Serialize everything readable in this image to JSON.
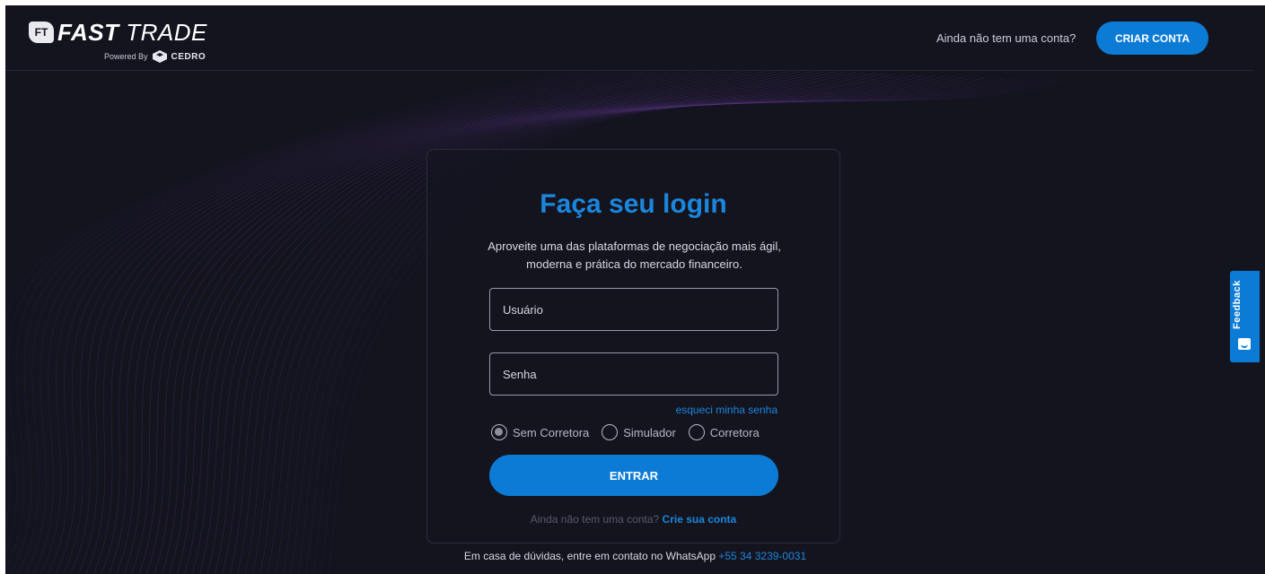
{
  "header": {
    "logo": {
      "badge": "FT",
      "brand_bold": "FAST",
      "brand_light": "TRADE",
      "powered_by": "Powered By",
      "partner": "CEDRO"
    },
    "question": "Ainda não tem uma conta?",
    "create_account_label": "CRIAR CONTA"
  },
  "login": {
    "title": "Faça seu login",
    "subtitle_line1": "Aproveite uma das plataformas de negociação mais ágil,",
    "subtitle_line2": "moderna e prática do mercado financeiro.",
    "username_placeholder": "Usuário",
    "password_placeholder": "Senha",
    "forgot_password": "esqueci minha senha",
    "account_types": [
      {
        "label": "Sem Corretora",
        "selected": true
      },
      {
        "label": "Simulador",
        "selected": false
      },
      {
        "label": "Corretora",
        "selected": false
      }
    ],
    "submit_label": "ENTRAR",
    "footer_question": "Ainda não tem uma conta?",
    "footer_link": "Crie sua conta"
  },
  "contact": {
    "text": "Em casa de dúvidas, entre em contato no WhatsApp",
    "phone": "+55 34 3239-0031"
  },
  "feedback": {
    "label": "Feedback",
    "icon": "smile-icon"
  },
  "colors": {
    "background": "#14141f",
    "accent": "#0c7bd6",
    "title": "#1b86dc",
    "waves": "#6b3fa0"
  }
}
